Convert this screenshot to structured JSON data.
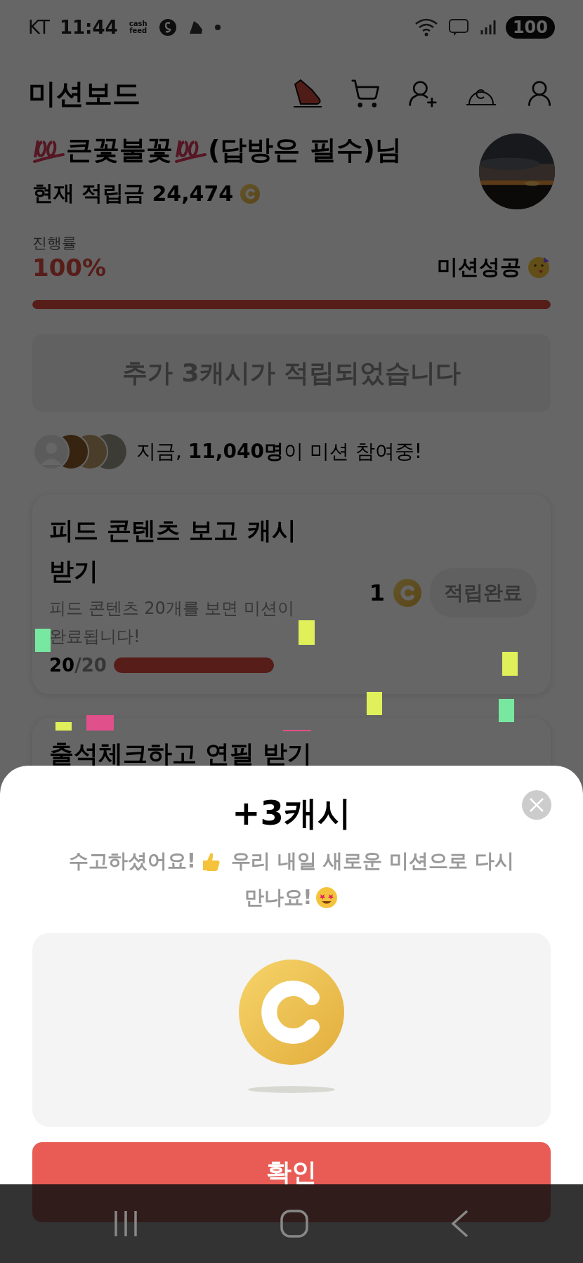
{
  "status_bar": {
    "carrier": "KT",
    "time": "11:44",
    "app_label": "cash feed",
    "battery": "100"
  },
  "header": {
    "title": "미션보드"
  },
  "profile": {
    "name": "큰꽃불꽃",
    "suffix": "(답방은 필수)님",
    "balance_label": "현재 적립금",
    "balance": "24,474"
  },
  "progress": {
    "label": "진행률",
    "percent": "100%",
    "level": 1,
    "status": "미션성공"
  },
  "notice": "추가 3캐시가 적립되었습니다",
  "participants": "지금, **11,040명**이 미션 참여중!",
  "missions": [
    {
      "title": "피드 콘텐츠 보고 캐시 받기",
      "description": "피드 콘텐츠 20개를 보면 미션이 완료됩니다!",
      "done": "20",
      "total": "/20",
      "level": 1,
      "reward": "1",
      "button": "적립완료",
      "completed": true
    },
    {
      "title": "출석체크하고 연필 받기"
    }
  ],
  "sheet": {
    "title": "+3캐시",
    "message": [
      "수고하셨어요!",
      "우리 내일 새로운 미션으로 다시",
      "만나요!"
    ],
    "button": "확인"
  }
}
